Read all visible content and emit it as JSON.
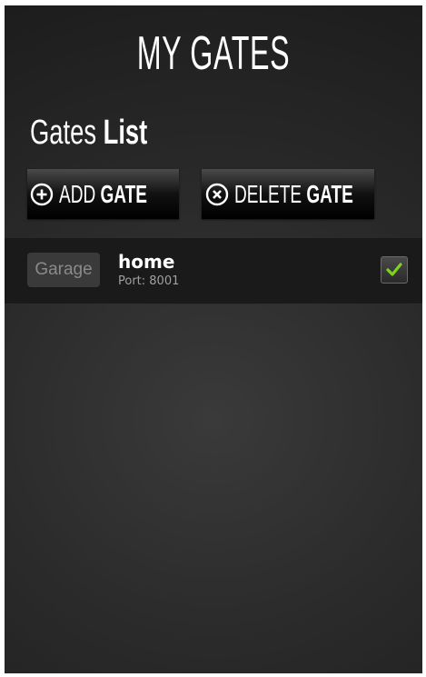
{
  "header": {
    "title": "MY GATES"
  },
  "section": {
    "title_light": "Gates",
    "title_bold": "List"
  },
  "toolbar": {
    "add_light": "ADD",
    "add_bold": "GATE",
    "add_icon": "plus-circle-icon",
    "delete_light": "DELETE",
    "delete_bold": "GATE",
    "delete_icon": "x-circle-icon"
  },
  "gates": [
    {
      "type": "Garage",
      "name": "home",
      "port": "Port: 8001",
      "checked": true
    }
  ],
  "colors": {
    "check_accent": "#7ed321",
    "row_background": "#1a1a1a"
  }
}
